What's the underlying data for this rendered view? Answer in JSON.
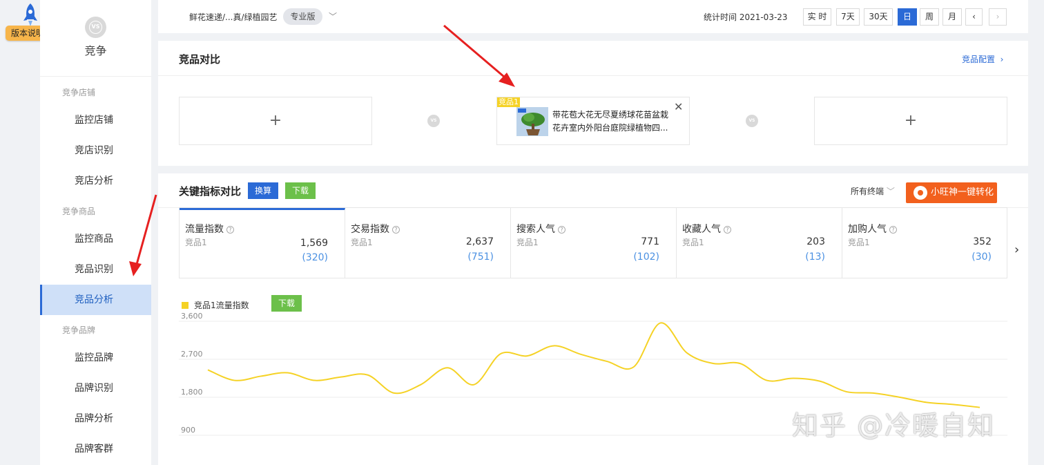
{
  "rail": {
    "badge": "版本说明"
  },
  "sidebar": {
    "vs_icon": "VS",
    "title": "竞争",
    "sections": [
      {
        "label": "竞争店铺",
        "items": [
          "监控店铺",
          "竞店识别",
          "竞店分析"
        ]
      },
      {
        "label": "竞争商品",
        "items": [
          "监控商品",
          "竞品识别",
          "竞品分析"
        ]
      },
      {
        "label": "竞争品牌",
        "items": [
          "监控品牌",
          "品牌识别",
          "品牌分析",
          "品牌客群"
        ]
      }
    ],
    "active": "竞品分析"
  },
  "topbar": {
    "breadcrumb": "鲜花速递/...真/绿植园艺",
    "edition": "专业版",
    "stat_time": "统计时间 2021-03-23",
    "ranges": [
      "实 时",
      "7天",
      "30天",
      "日",
      "周",
      "月"
    ],
    "active_range": "日",
    "prev": "‹",
    "next": "›"
  },
  "compare": {
    "title": "竞品对比",
    "config_link": "竞品配置",
    "plus": "+",
    "vs": "VS",
    "product": {
      "tag": "竞品1",
      "name": "带花苞大花无尽夏绣球花苗盆栽花卉室内外阳台庭院绿植物四..."
    }
  },
  "kpi": {
    "title": "关键指标对比",
    "convert_btn": "换算",
    "download_btn": "下载",
    "terminal": "所有终端",
    "xiaowang_btn": "小旺神一键转化",
    "metrics": [
      {
        "name": "流量指数",
        "sub": "竞品1",
        "value": "1,569",
        "diff": "(320)"
      },
      {
        "name": "交易指数",
        "sub": "竞品1",
        "value": "2,637",
        "diff": "(751)"
      },
      {
        "name": "搜索人气",
        "sub": "竞品1",
        "value": "771",
        "diff": "(102)"
      },
      {
        "name": "收藏人气",
        "sub": "竞品1",
        "value": "203",
        "diff": "(13)"
      },
      {
        "name": "加购人气",
        "sub": "竞品1",
        "value": "352",
        "diff": "(30)"
      }
    ],
    "next": "›"
  },
  "chart_data": {
    "type": "line",
    "legend": "竞品1流量指数",
    "download_btn": "下载",
    "y_ticks": [
      "3,600",
      "2,700",
      "1,800",
      "900"
    ],
    "ylim": [
      900,
      3600
    ],
    "grid": true,
    "series": [
      {
        "name": "竞品1流量指数",
        "color": "#f5d225",
        "values": [
          2450,
          2200,
          2300,
          2380,
          2200,
          2280,
          2330,
          1900,
          2100,
          2500,
          2100,
          2830,
          2780,
          3020,
          2820,
          2650,
          2520,
          3560,
          2850,
          2600,
          2600,
          2200,
          2250,
          2180,
          1930,
          1900,
          1800,
          1680,
          1630,
          1560
        ]
      }
    ]
  },
  "watermark": "知乎 @冷暖自知"
}
